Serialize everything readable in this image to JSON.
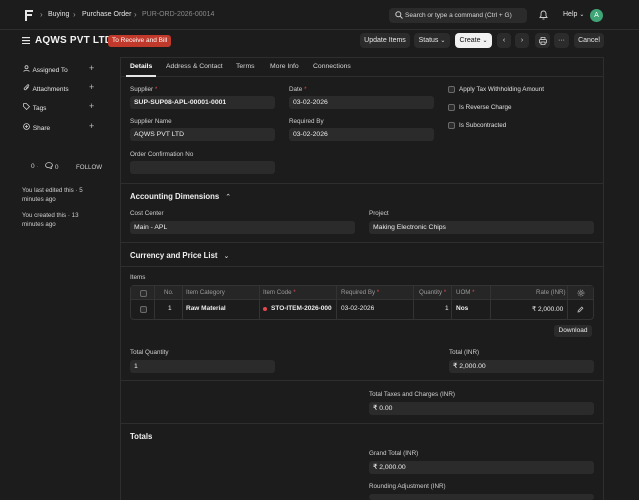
{
  "topbar": {
    "crumbs": [
      "Buying",
      "Purchase Order",
      "PUR-ORD-2026-00014"
    ],
    "search_placeholder": "Search or type a command (Ctrl + G)",
    "help_label": "Help",
    "avatar_letter": "A"
  },
  "header": {
    "title": "AQWS PVT LTD",
    "status_badge": "To Receive and Bill",
    "update_items": "Update Items",
    "status_btn": "Status",
    "create_btn": "Create",
    "cancel_btn": "Cancel"
  },
  "sidebar": {
    "assigned_to": "Assigned To",
    "attachments": "Attachments",
    "tags": "Tags",
    "share": "Share",
    "likes": "0",
    "comments": "0",
    "follow": "FOLLOW",
    "edited": "You last edited this · 5 minutes ago",
    "created": "You created this · 13 minutes ago"
  },
  "tabs": [
    "Details",
    "Address & Contact",
    "Terms",
    "More Info",
    "Connections"
  ],
  "details": {
    "supplier_label": "Supplier",
    "supplier_value": "SUP-SUP08-APL-00001-0001",
    "date_label": "Date",
    "date_value": "03-02-2026",
    "supplier_name_label": "Supplier Name",
    "supplier_name_value": "AQWS PVT LTD",
    "required_by_label": "Required By",
    "required_by_value": "03-02-2026",
    "order_conf_label": "Order Confirmation No",
    "apply_tax": "Apply Tax Withholding Amount",
    "reverse_charge": "Is Reverse Charge",
    "subcontracted": "Is Subcontracted"
  },
  "accounting": {
    "title": "Accounting Dimensions",
    "cost_center_label": "Cost Center",
    "cost_center_value": "Main - APL",
    "project_label": "Project",
    "project_value": "Making Electronic Chips"
  },
  "currency": {
    "title": "Currency and Price List"
  },
  "items": {
    "label": "Items",
    "headers": {
      "no": "No.",
      "category": "Item Category",
      "code": "Item Code",
      "required_by": "Required By",
      "qty": "Quantity",
      "uom": "UOM",
      "rate": "Rate (INR)"
    },
    "row": {
      "no": "1",
      "category": "Raw Material",
      "code": "STO-ITEM-2026-000",
      "required_by": "03-02-2026",
      "qty": "1",
      "uom": "Nos",
      "rate": "₹ 2,000.00"
    },
    "download": "Download"
  },
  "totals_fields": {
    "total_qty_label": "Total Quantity",
    "total_qty_value": "1",
    "total_label": "Total (INR)",
    "total_value": "₹ 2,000.00",
    "taxes_label": "Total Taxes and Charges (INR)",
    "taxes_value": "₹ 0.00"
  },
  "totals": {
    "title": "Totals",
    "grand_total_label": "Grand Total (INR)",
    "grand_total_value": "₹ 2,000.00",
    "rounding_label": "Rounding Adjustment (INR)"
  },
  "colors": {
    "accent_badge": "#c0392b",
    "avatar": "#3fa577",
    "background": "#1c1c1c"
  }
}
